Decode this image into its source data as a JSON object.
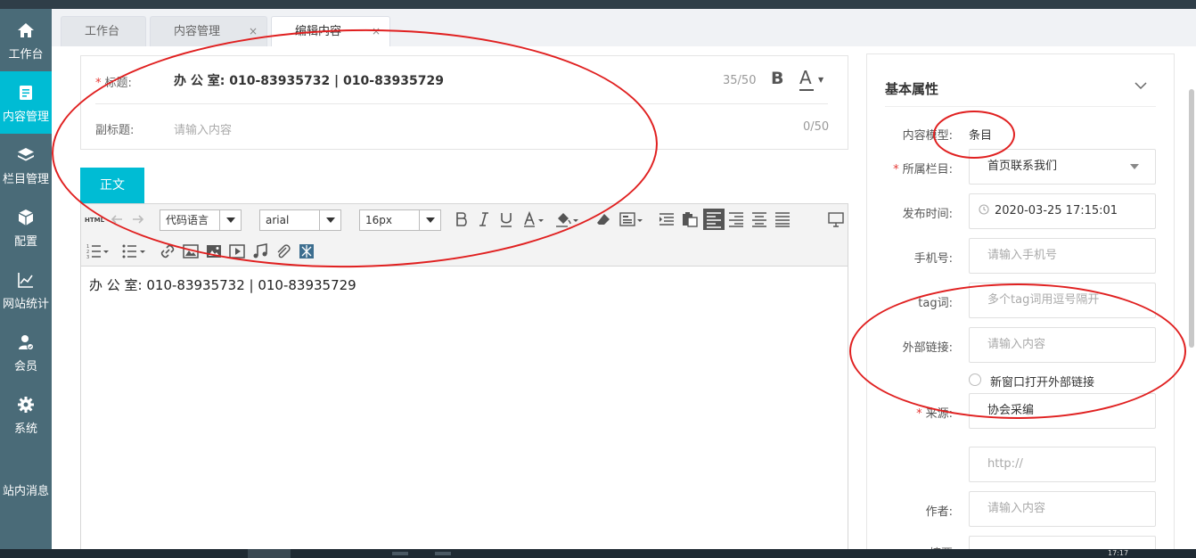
{
  "sidebar": {
    "items": [
      {
        "label": "工作台",
        "icon": "home-icon"
      },
      {
        "label": "内容管理",
        "icon": "document-edit-icon",
        "active": true
      },
      {
        "label": "栏目管理",
        "icon": "layers-icon"
      },
      {
        "label": "配置",
        "icon": "cube-icon"
      },
      {
        "label": "网站统计",
        "icon": "line-chart-icon"
      },
      {
        "label": "会员",
        "icon": "member-icon"
      },
      {
        "label": "系统",
        "icon": "gear-icon"
      },
      {
        "label": "站内消息",
        "icon": "message-icon"
      }
    ]
  },
  "tabs": [
    {
      "label": "工作台"
    },
    {
      "label": "内容管理",
      "close": "×"
    },
    {
      "label": "编辑内容",
      "close": "×",
      "active": true
    }
  ],
  "title_section": {
    "required_mark": "*",
    "title_label": "标题:",
    "title_value": "办 公 室: 010-83935732 | 010-83935729",
    "title_counter": "35/50",
    "bold_label": "B",
    "color_label": "A",
    "subtitle_label": "副标题:",
    "subtitle_placeholder": "请输入内容",
    "subtitle_counter": "0/50"
  },
  "body_tab": {
    "label": "正文"
  },
  "editor": {
    "html_label": "HTML",
    "code_language": "代码语言",
    "font_family": "arial",
    "font_size": "16px",
    "content": "办 公 室: 010-83935732 | 010-83935729"
  },
  "properties": {
    "title": "基本属性",
    "required_mark": "*",
    "content_model_label": "内容模型:",
    "content_model_value": "条目",
    "column_label": "所属栏目:",
    "column_value": "首页联系我们",
    "publish_time_label": "发布时间:",
    "publish_time_value": "2020-03-25 17:15:01",
    "phone_label": "手机号:",
    "phone_placeholder": "请输入手机号",
    "tag_label": "tag词:",
    "tag_placeholder": "多个tag词用逗号隔开",
    "external_link_label": "外部链接:",
    "external_link_placeholder": "请输入内容",
    "new_window_label": "新窗口打开外部链接",
    "source_label": "来源:",
    "source_value": "协会采编",
    "source_url_placeholder": "http://",
    "author_label": "作者:",
    "author_placeholder": "请输入内容",
    "summary_label": "摘要"
  },
  "taskbar": {
    "clock": "17:17"
  },
  "colors": {
    "accent": "#00bcd4",
    "sidebar": "#4a6b78",
    "annotation": "#e02020",
    "required": "#e53935"
  }
}
